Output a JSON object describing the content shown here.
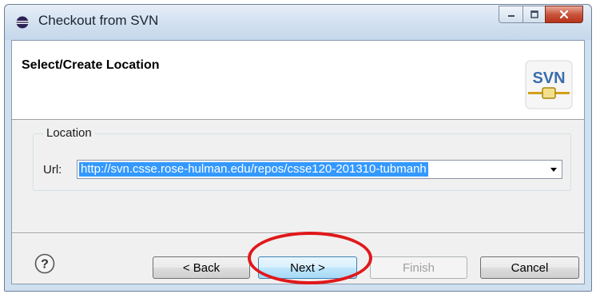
{
  "window": {
    "title": "Checkout from SVN",
    "icon": "eclipse-icon"
  },
  "header": {
    "title": "Select/Create Location",
    "logo_text": "SVN"
  },
  "location_group": {
    "label": "Location",
    "url_label": "Url:",
    "url_value": "http://svn.csse.rose-hulman.edu/repos/csse120-201310-tubmanh"
  },
  "buttons": {
    "back": "< Back",
    "next": "Next >",
    "finish": "Finish",
    "cancel": "Cancel"
  },
  "colors": {
    "selection": "#3399ff",
    "annotation_ring": "#e0181b"
  }
}
